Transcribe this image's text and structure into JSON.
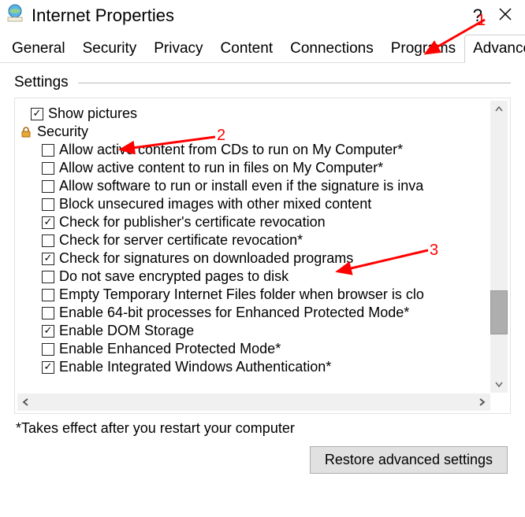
{
  "titlebar": {
    "title": "Internet Properties",
    "help": "?",
    "close": "✕"
  },
  "tabs": [
    "General",
    "Security",
    "Privacy",
    "Content",
    "Connections",
    "Programs",
    "Advanced"
  ],
  "active_tab_index": 6,
  "group_label": "Settings",
  "settings": {
    "leading_item": {
      "label": "Show pictures",
      "checked": true
    },
    "section_label": "Security",
    "items": [
      {
        "label": "Allow active content from CDs to run on My Computer*",
        "checked": false
      },
      {
        "label": "Allow active content to run in files on My Computer*",
        "checked": false
      },
      {
        "label": "Allow software to run or install even if the signature is inva",
        "checked": false
      },
      {
        "label": "Block unsecured images with other mixed content",
        "checked": false
      },
      {
        "label": "Check for publisher's certificate revocation",
        "checked": true
      },
      {
        "label": "Check for server certificate revocation*",
        "checked": false
      },
      {
        "label": "Check for signatures on downloaded programs",
        "checked": true
      },
      {
        "label": "Do not save encrypted pages to disk",
        "checked": false
      },
      {
        "label": "Empty Temporary Internet Files folder when browser is clo",
        "checked": false
      },
      {
        "label": "Enable 64-bit processes for Enhanced Protected Mode*",
        "checked": false
      },
      {
        "label": "Enable DOM Storage",
        "checked": true
      },
      {
        "label": "Enable Enhanced Protected Mode*",
        "checked": false
      },
      {
        "label": "Enable Integrated Windows Authentication*",
        "checked": true
      }
    ]
  },
  "note": "*Takes effect after you restart your computer",
  "restore_button": "Restore advanced settings",
  "annotations": {
    "n1": "1",
    "n2": "2",
    "n3": "3"
  }
}
